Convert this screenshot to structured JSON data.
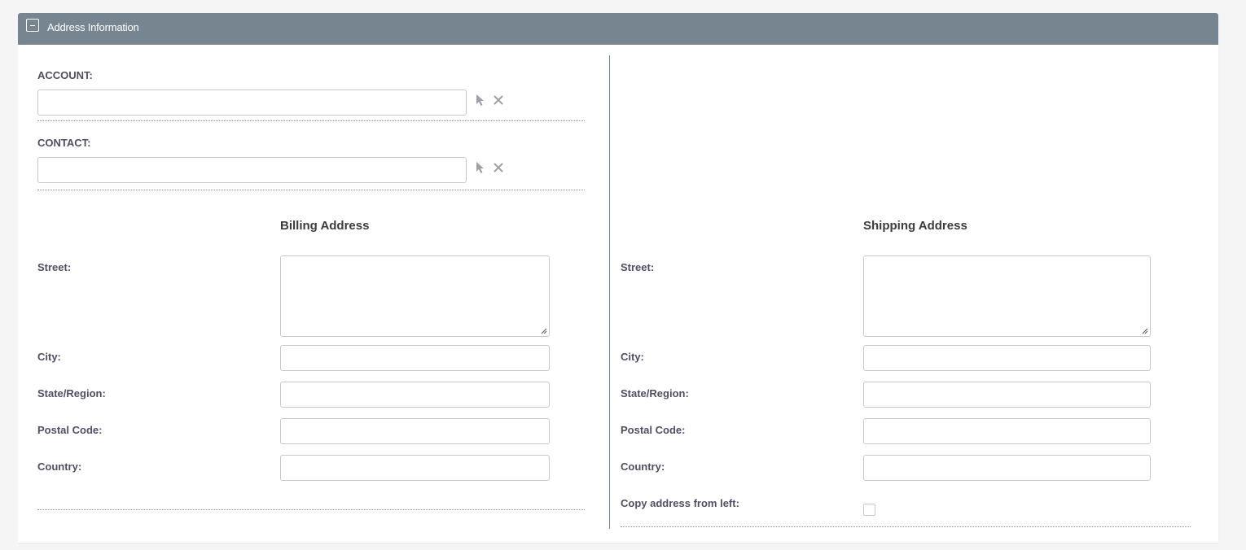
{
  "panel": {
    "title": "Address Information",
    "collapse_icon": "minus-box-icon"
  },
  "account": {
    "label": "ACCOUNT:",
    "value": "",
    "select_icon": "cursor-select-icon",
    "clear_icon": "close-icon"
  },
  "contact": {
    "label": "CONTACT:",
    "value": "",
    "select_icon": "cursor-select-icon",
    "clear_icon": "close-icon"
  },
  "billing": {
    "title": "Billing Address",
    "street_label": "Street:",
    "city_label": "City:",
    "state_label": "State/Region:",
    "postal_label": "Postal Code:",
    "country_label": "Country:",
    "street": "",
    "city": "",
    "state": "",
    "postal": "",
    "country": ""
  },
  "shipping": {
    "title": "Shipping Address",
    "street_label": "Street:",
    "city_label": "City:",
    "state_label": "State/Region:",
    "postal_label": "Postal Code:",
    "country_label": "Country:",
    "copy_label": "Copy address from left:",
    "copy_checked": false,
    "street": "",
    "city": "",
    "state": "",
    "postal": "",
    "country": ""
  },
  "colors": {
    "header_bg": "#778591",
    "label": "#534d64",
    "border": "#c7c7c7"
  }
}
